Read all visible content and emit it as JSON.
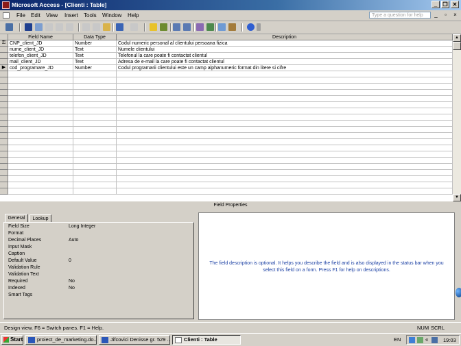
{
  "window": {
    "title": "Microsoft Access - [Clienti : Table]",
    "minimize": "_",
    "restore": "❐",
    "close": "✕"
  },
  "menu": {
    "items": [
      "File",
      "Edit",
      "View",
      "Insert",
      "Tools",
      "Window",
      "Help"
    ],
    "help_placeholder": "Type a question for help"
  },
  "table": {
    "headers": [
      "Field Name",
      "Data Type",
      "Description"
    ],
    "rows": [
      {
        "field": "CNP_client_JD",
        "type": "Number",
        "description": "Codul numeric personal al clientului persoana fizica",
        "marker": "⚿"
      },
      {
        "field": "nume_client_JD",
        "type": "Text",
        "description": "Numele clientului",
        "marker": ""
      },
      {
        "field": "telefon_client_JD",
        "type": "Text",
        "description": "Telefonul la care poate fi contactat clientul",
        "marker": ""
      },
      {
        "field": "mail_client_JD",
        "type": "Text",
        "description": "Adresa de e-mail la care poate fi contactat clientul",
        "marker": ""
      },
      {
        "field": "cod_programare_JD",
        "type": "Number",
        "description": "Codul programarii clientului este un camp alphanumeric format din litere si cifre",
        "marker": "▶"
      }
    ]
  },
  "field_properties": {
    "title": "Field Properties",
    "tabs": [
      "General",
      "Lookup"
    ],
    "rows": [
      {
        "label": "Field Size",
        "value": "Long Integer"
      },
      {
        "label": "Format",
        "value": ""
      },
      {
        "label": "Decimal Places",
        "value": "Auto"
      },
      {
        "label": "Input Mask",
        "value": ""
      },
      {
        "label": "Caption",
        "value": ""
      },
      {
        "label": "Default Value",
        "value": "0"
      },
      {
        "label": "Validation Rule",
        "value": ""
      },
      {
        "label": "Validation Text",
        "value": ""
      },
      {
        "label": "Required",
        "value": "No"
      },
      {
        "label": "Indexed",
        "value": "No"
      },
      {
        "label": "Smart Tags",
        "value": ""
      }
    ],
    "description_line1": "The field description is optional.  It helps you describe the field and is also displayed in the status bar when you",
    "description_line2": "select this field on a form.  Press F1 for help on descriptions."
  },
  "status": {
    "text": "Design view.  F6 = Switch panes.  F1 = Help.",
    "num": "NUM",
    "scrl": "SCRL"
  },
  "taskbar": {
    "start": "Start",
    "tasks": [
      {
        "label": "proiect_de_marketing.do...",
        "active": false
      },
      {
        "label": "Jifcovici Denisse gr. 529 ...",
        "active": false
      },
      {
        "label": "Clienti : Table",
        "active": true
      }
    ],
    "lang": "EN",
    "clock": "19:03",
    "tray_chevron": "«"
  },
  "colors": {
    "title_gradient_start": "#0a246a",
    "title_gradient_end": "#a6caf0",
    "description_text": "#1a3fa3"
  }
}
